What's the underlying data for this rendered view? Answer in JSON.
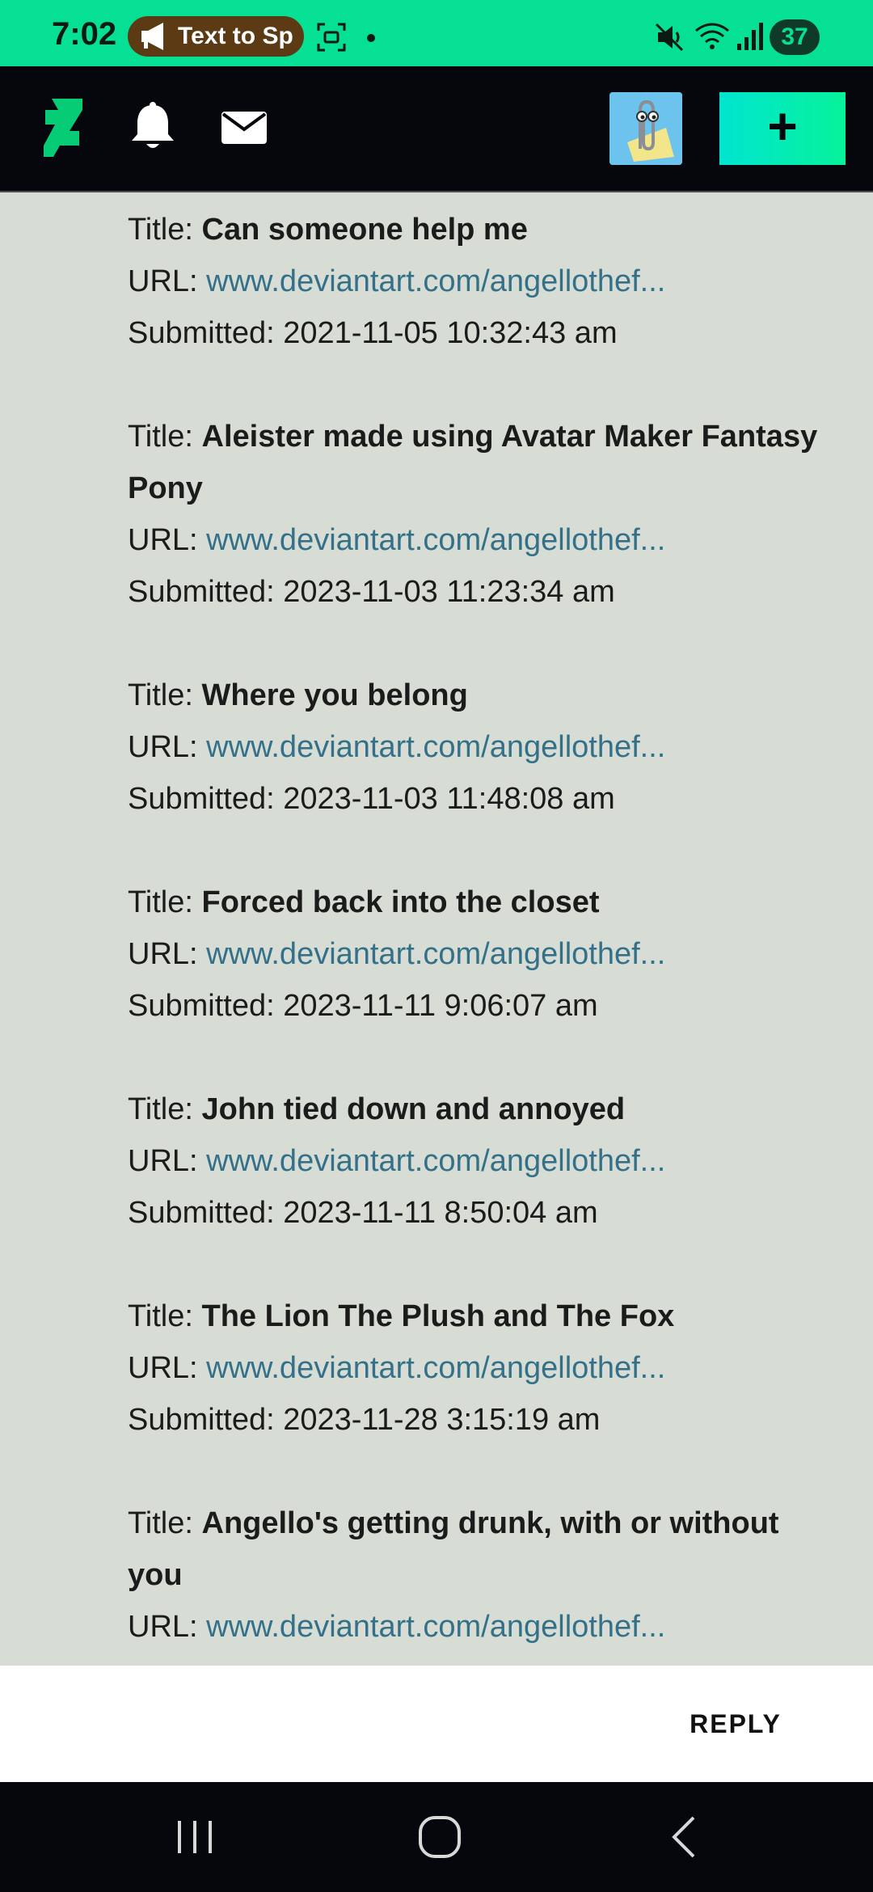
{
  "status_bar": {
    "time": "7:02",
    "tts_label": "Text to Sp",
    "battery": "37",
    "accent_color": "#06e094"
  },
  "header": {
    "logo": "deviantart-logo-icon",
    "notifications_icon": "bell-icon",
    "messages_icon": "mail-icon",
    "create_label": "+"
  },
  "submissions": [
    {
      "title_label": "Title:",
      "title": "Can someone help me",
      "url_label": "URL:",
      "url": "www.deviantart.com/angellothef...",
      "submitted_label": "Submitted:",
      "submitted": "2021-11-05 10:32:43 am"
    },
    {
      "title_label": "Title:",
      "title": "Aleister made using Avatar Maker Fantasy Pony",
      "url_label": "URL:",
      "url": "www.deviantart.com/angellothef...",
      "submitted_label": "Submitted:",
      "submitted": "2023-11-03 11:23:34 am"
    },
    {
      "title_label": "Title:",
      "title": "Where you belong",
      "url_label": "URL:",
      "url": "www.deviantart.com/angellothef...",
      "submitted_label": "Submitted:",
      "submitted": "2023-11-03 11:48:08 am"
    },
    {
      "title_label": "Title:",
      "title": "Forced back into the closet",
      "url_label": "URL:",
      "url": "www.deviantart.com/angellothef...",
      "submitted_label": "Submitted:",
      "submitted": "2023-11-11 9:06:07 am"
    },
    {
      "title_label": "Title:",
      "title": "John tied down and annoyed",
      "url_label": "URL:",
      "url": "www.deviantart.com/angellothef...",
      "submitted_label": "Submitted:",
      "submitted": "2023-11-11 8:50:04 am"
    },
    {
      "title_label": "Title:",
      "title": "The Lion The Plush and The Fox",
      "url_label": "URL:",
      "url": "www.deviantart.com/angellothef...",
      "submitted_label": "Submitted:",
      "submitted": "2023-11-28 3:15:19 am"
    },
    {
      "title_label": "Title:",
      "title": "Angello's getting drunk, with or without you",
      "url_label": "URL:",
      "url": "www.deviantart.com/angellothef...",
      "submitted_label": "Submitted:",
      "submitted": ""
    }
  ],
  "reply_bar": {
    "reply_label": "REPLY"
  },
  "colors": {
    "background": "#d7ddd5",
    "link": "#347188",
    "header": "#06070d",
    "create_button": "#00e5d0"
  }
}
